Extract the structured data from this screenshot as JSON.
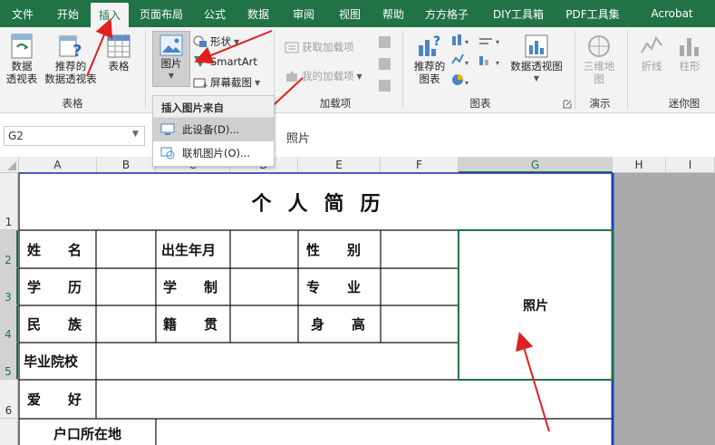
{
  "ribbon_tabs": [
    "文件",
    "开始",
    "插入",
    "页面布局",
    "公式",
    "数据",
    "审阅",
    "视图",
    "帮助",
    "方方格子",
    "DIY工具箱",
    "PDF工具集",
    "Acrobat"
  ],
  "tables_group": {
    "pivot_label_1": "数据",
    "pivot_label_2": "透视表",
    "recommended_label_1": "推荐的",
    "recommended_label_2": "数据透视表",
    "table_label": "表格",
    "group_label": "表格"
  },
  "illustrations": {
    "pictures_label": "图片",
    "shapes_label": "形状",
    "smartart_label": "SmartArt",
    "screenshot_label": "屏幕截图"
  },
  "addins": {
    "get_addins": "获取加载项",
    "my_addins": "我的加载项",
    "group_label": "加载项"
  },
  "charts": {
    "recommended_label_1": "推荐的",
    "recommended_label_2": "图表",
    "pivot_chart_label": "数据透视图",
    "group_label": "图表"
  },
  "tours": {
    "map3d_label_1": "三维地",
    "map3d_label_2": "图",
    "group_label": "演示"
  },
  "sparklines": {
    "line_label": "折线",
    "column_label": "柱形",
    "group_label": "迷你图"
  },
  "pictures_menu": {
    "header": "插入图片来自",
    "this_device": "此设备(D)...",
    "online_pictures": "联机图片(O)..."
  },
  "formula_bar": {
    "name_box": "G2",
    "formula": "照片"
  },
  "columns": [
    "A",
    "B",
    "C",
    "D",
    "E",
    "F",
    "G",
    "H",
    "I"
  ],
  "rows": [
    "1",
    "2",
    "3",
    "4",
    "5",
    "6"
  ],
  "sheet": {
    "title": "个人简历",
    "name_label": "姓　　名",
    "birth_label": "出生年月",
    "gender_label": "性　　别",
    "edu_label": "学　　历",
    "schooling_label": "学　　制",
    "major_label": "专　　业",
    "ethnic_label": "民　　族",
    "native_label": "籍　　贯",
    "height_label": "身　　高",
    "school_label": "毕业院校",
    "hobby_label": "爱　　好",
    "hukou_label": "户口所在地",
    "photo_label": "照片"
  },
  "colors": {
    "excel_green": "#217346",
    "arrow_red": "#e02020",
    "menu_highlight": "#cfcfcf"
  }
}
